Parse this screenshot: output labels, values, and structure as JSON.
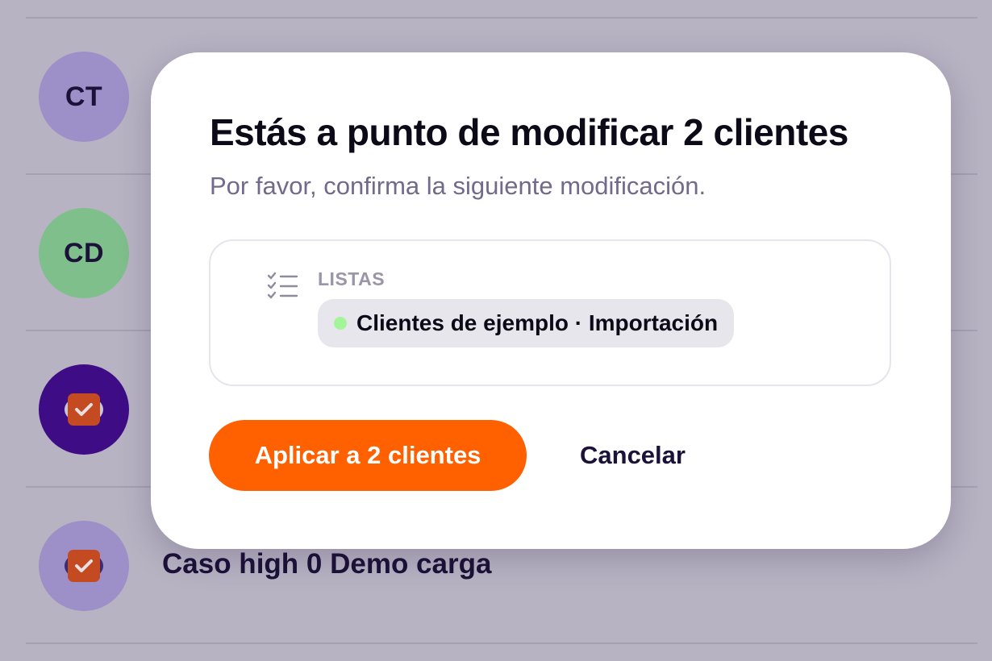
{
  "background_list": {
    "rows": [
      {
        "avatar_text": "CT",
        "avatar_color": "#9d8fc7",
        "title": ""
      },
      {
        "avatar_text": "CD",
        "avatar_color": "#7fbf8c",
        "title": ""
      },
      {
        "avatar_icon": "checkbox-badge-icon",
        "avatar_color": "#3e0d86",
        "title": ""
      },
      {
        "avatar_icon": "checkbox-badge-icon",
        "avatar_color": "#9d8fc7",
        "title": "Caso high 0 Demo carga"
      }
    ]
  },
  "modal": {
    "title": "Estás a punto de modificar 2 clientes",
    "subtitle": "Por favor, confirma la siguiente modificación.",
    "change": {
      "icon": "checklist-icon",
      "label": "LISTAS",
      "tag_text": "Clientes de ejemplo · Importación",
      "tag_dot_color": "#a4f59a"
    },
    "apply_label": "Aplicar a 2 clientes",
    "cancel_label": "Cancelar",
    "accent_color": "#ff6000"
  }
}
